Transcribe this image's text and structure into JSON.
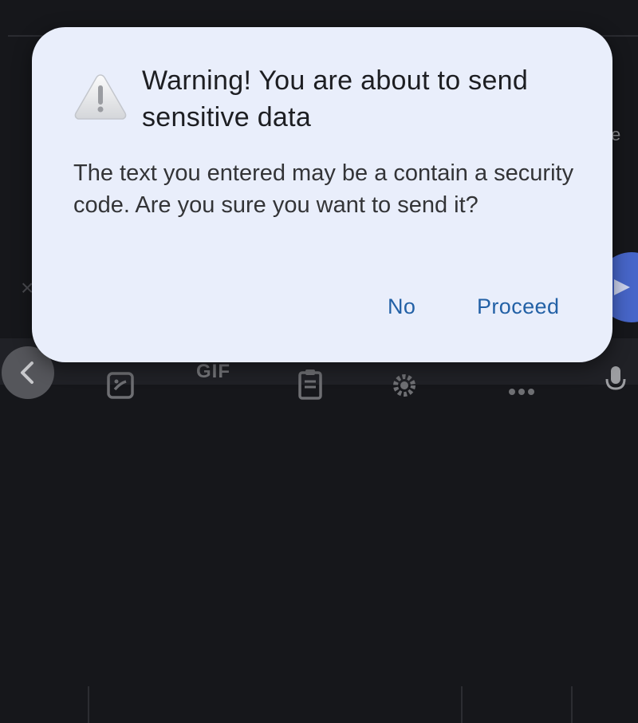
{
  "background": {
    "partial_text": "e",
    "close_glyph": "×",
    "toolbar": {
      "gif_label": "GIF",
      "icons": [
        "back-icon",
        "sticker-icon",
        "gif-icon",
        "clipboard-icon",
        "settings-icon",
        "more-icon",
        "microphone-icon"
      ]
    },
    "send_icon": "send-icon"
  },
  "dialog": {
    "icon": "warning-icon",
    "title": "Warning! You are about to send sensitive data",
    "body": "The text you entered may be a contain a security code. Are you sure you want to send it?",
    "buttons": {
      "no": "No",
      "proceed": "Proceed"
    }
  },
  "colors": {
    "dialog_bg": "#e9eefb",
    "accent": "#2361a6",
    "send_fab": "#4766c9"
  }
}
